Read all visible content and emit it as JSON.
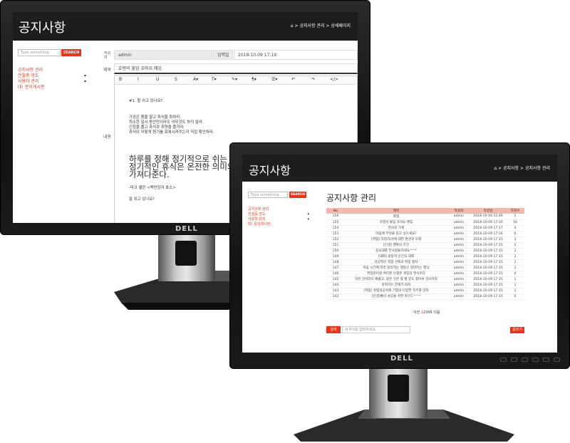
{
  "back_screen": {
    "header": {
      "title": "공지사항",
      "breadcrumb": [
        "공지사항 관리",
        "상세페이지"
      ],
      "separator": ">"
    },
    "sidebar": {
      "search_placeholder": "Type something",
      "search_button": "SEARCH",
      "menu": [
        "공지사항 관리",
        "전월중 앙도",
        "사용자 관리",
        "대! 문의게시판"
      ]
    },
    "form": {
      "author_label": "작성자",
      "author_value": "admin",
      "date_label": "입력일",
      "date_value": "2018-10-09 17:19",
      "subject_label": "제목",
      "subject_value": "호텐의 불암 호마요 매임",
      "content_label": "내용",
      "toolbar": [
        "B",
        "I",
        "U",
        "S",
        "A▾",
        "T▾",
        "✎▾",
        "¶▾",
        "☰▾",
        "↶",
        "↷",
        "</>"
      ],
      "lines": [
        "#1. 할 쉬고 있나요?",
        "",
        "가끔은 좀을 찰고 휴식을 취하라.",
        "최소한 일시 동안만이라도 아무것도 하지 말라.",
        "긴장을 풀고 휴식과 휴양을 즐겨라.",
        "휴식이 어떻게 원기를 회복시켜주는지 직접 확인하라."
      ],
      "big_lines": [
        "하루를 정해 정기적으로 쉬는 것을 매우 중요하다.",
        "정기적인 휴식은 온전한 의미의",
        "가져다준다."
      ],
      "after_lines": [
        "-마크 엘런 <백만장자 효소>",
        "",
        "잘 쉬고 있나요?"
      ]
    }
  },
  "front_screen": {
    "header": {
      "title": "공지사항",
      "breadcrumb": [
        "공지사항",
        "공지사항 관리"
      ],
      "separator": ">"
    },
    "sidebar": {
      "search_placeholder": "Type something",
      "search_button": "SEARCH",
      "menu": [
        "공지사항 관리",
        "전월중 앙도",
        "사용자 관리",
        "대! 문의게시판"
      ]
    },
    "page_title": "공지사항 관리",
    "table": {
      "columns": [
        "No",
        "제목",
        "작성자",
        "작성일",
        "조회수"
      ],
      "rows": [
        [
          "156",
          "화업",
          "admin",
          "2018-10-16 12:46",
          "1"
        ],
        [
          "155",
          "호텐의 불암 호마요 매임",
          "admin",
          "2018-10-09 17:19",
          "16"
        ],
        [
          "154",
          "현사의 가게",
          "admin",
          "2018-10-09 17:17",
          "4"
        ],
        [
          "153",
          "마음에 무엇을 담고 싶으세요?",
          "admin",
          "2018-10-09 17:16",
          "6"
        ],
        [
          "152",
          "[취업] 직업/직성에 대한 편견과 오해",
          "admin",
          "2018-10-09 17:15",
          "3"
        ],
        [
          "151",
          "[인생] 행복의 조건",
          "admin",
          "2018-10-09 17:15",
          "2"
        ],
        [
          "150",
          "중요대를 한사람들하세요^^*",
          "admin",
          "2018-10-09 17:15",
          "2"
        ],
        [
          "149",
          "[대화] 갈망적 순간의 대화",
          "admin",
          "2018-10-09 17:15",
          "2"
        ],
        [
          "148",
          "성공적인 직업 선택과 취업 절차",
          "admin",
          "2018-10-09 17:15",
          "2"
        ],
        [
          "147",
          "목숨 시간에 따라 달라지는 행동신 달라지는 행식",
          "admin",
          "2018-10-09 17:15",
          "2"
        ],
        [
          "146",
          "취업준비생 여러분 인생은 게임의 연속이다",
          "admin",
          "2018-10-09 17:15",
          "0"
        ],
        [
          "145",
          "작은 것이라도 배풀고, 받은 것은 몇 벨 갚도 찾아서 감사하라",
          "admin",
          "2018-10-09 17:15",
          "1"
        ],
        [
          "144",
          "성취하는 한해가 되자",
          "admin",
          "2018-10-09 17:15",
          "1"
        ],
        [
          "143",
          "[취업] 취업성공위해 기업의 다양한 직무를 알자",
          "admin",
          "2018-10-09 17:15",
          "1"
        ],
        [
          "142",
          "[인생]좋의 성공을 위한 마인드^^*",
          "admin",
          "2018-10-09 17:15",
          "0"
        ]
      ]
    },
    "pager": {
      "prev": "이전",
      "pages": [
        "1",
        "2",
        "3",
        "4",
        "5"
      ],
      "current": "1",
      "next": "다음"
    },
    "bottom_search_button": "검색",
    "bottom_search_placeholder": "검색어를 입력하세요.",
    "write_button": "글쓰기"
  },
  "brand": "DELL",
  "colors": {
    "accent": "#e8341c",
    "header": "#1d1d1d",
    "table_header": "#f4b9ad"
  }
}
